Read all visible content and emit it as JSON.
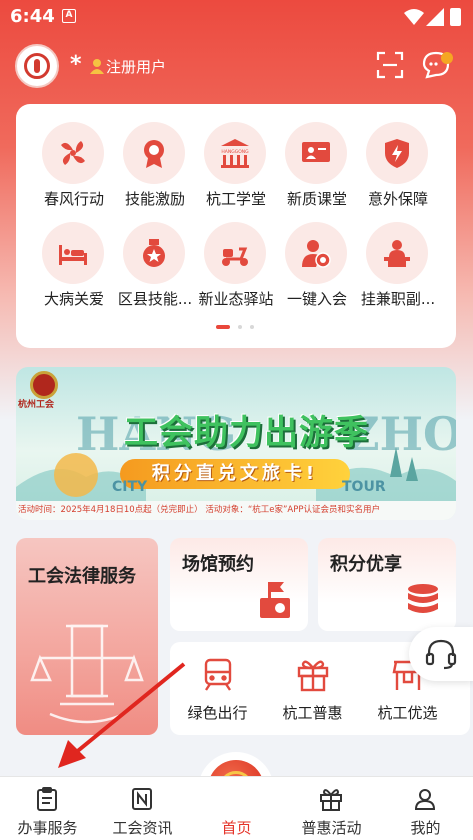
{
  "status_bar": {
    "time": "6:44",
    "notif_letter": "A"
  },
  "header": {
    "star": "*",
    "user_label": "注册用户"
  },
  "services": [
    {
      "label": "春风行动",
      "icon": "windmill-icon"
    },
    {
      "label": "技能激励",
      "icon": "medal-icon"
    },
    {
      "label": "杭工学堂",
      "icon": "hall-icon",
      "sign": "HANGGONG"
    },
    {
      "label": "新质课堂",
      "icon": "blackboard-icon"
    },
    {
      "label": "意外保障",
      "icon": "shield-bolt-icon"
    },
    {
      "label": "大病关爱",
      "icon": "bed-icon"
    },
    {
      "label": "区县技能...",
      "icon": "award-icon"
    },
    {
      "label": "新业态驿站",
      "icon": "scooter-icon"
    },
    {
      "label": "一键入会",
      "icon": "user-join-icon"
    },
    {
      "label": "挂兼职副...",
      "icon": "podium-icon"
    }
  ],
  "banner": {
    "brand": "杭州工会",
    "title": "工会助力出游季",
    "subtitle": "积分直兑文旅卡!",
    "bg_left": "HANG",
    "bg_right": "ZHOU",
    "city_word": "CITY",
    "tour_word": "TOUR",
    "footer": "活动时间：2025年4月18日10点起（兑完即止）    活动对象：“杭工e家”APP认证会员和实名用户"
  },
  "law_card": {
    "title": "工会法律服务"
  },
  "venue_card": {
    "title": "场馆预约"
  },
  "points_card": {
    "title": "积分优享"
  },
  "trio": [
    {
      "label": "绿色出行",
      "icon": "train-icon"
    },
    {
      "label": "杭工普惠",
      "icon": "gift-icon"
    },
    {
      "label": "杭工优选",
      "icon": "store-icon"
    }
  ],
  "tabs": [
    {
      "label": "办事服务",
      "icon": "clipboard-icon"
    },
    {
      "label": "工会资讯",
      "icon": "news-icon"
    },
    {
      "label": "首页",
      "icon": "union-logo-icon"
    },
    {
      "label": "普惠活动",
      "icon": "gift-icon"
    },
    {
      "label": "我的",
      "icon": "profile-icon"
    }
  ],
  "colors": {
    "accent": "#e9473b",
    "header_top": "#ec4a3f",
    "annotation_arrow": "#e0261f"
  }
}
